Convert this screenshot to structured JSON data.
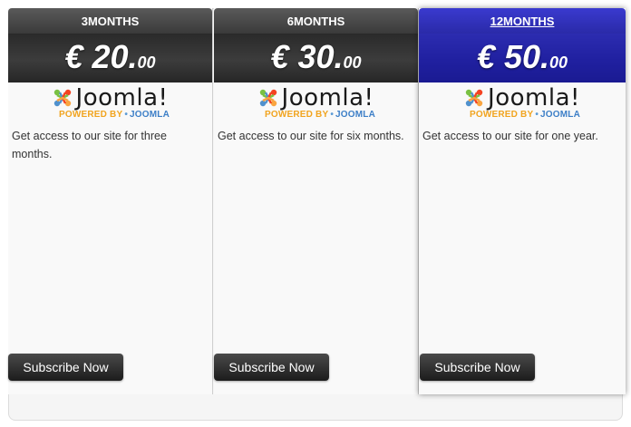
{
  "plans": [
    {
      "name": "3MONTHS",
      "price_main": "€ 20.",
      "price_cents": "00",
      "description": "Get access to our site for three months.",
      "button_label": "Subscribe Now"
    },
    {
      "name": "6MONTHS",
      "price_main": "€ 30.",
      "price_cents": "00",
      "description": "Get access to our site for six months.",
      "button_label": "Subscribe Now"
    },
    {
      "name": "12MONTHS",
      "price_main": "€ 50.",
      "price_cents": "00",
      "description": "Get access to our site for one year.",
      "button_label": "Subscribe Now",
      "featured": true
    }
  ],
  "logo": {
    "word": "Joomla!",
    "powered_by": "POWERED BY",
    "brand": "JOOMLA"
  },
  "colors": {
    "header_dark": "#3a3a3a",
    "header_featured": "#2a2aa8",
    "logo_orange": "#f1a41f",
    "logo_blue": "#3d7fc7"
  }
}
